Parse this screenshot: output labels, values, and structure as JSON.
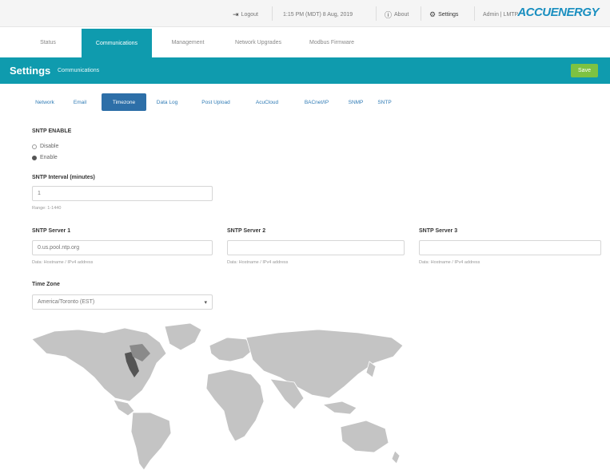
{
  "topbar": {
    "logout": "Logout",
    "datetime": "1:15 PM (MDT) 8 Aug, 2019",
    "about": "About",
    "settings": "Settings",
    "user": "Admin | LMTP",
    "brand": "ACCUENERGY"
  },
  "nav": {
    "tabs": [
      "Status",
      "Communications",
      "Management",
      "Network Upgrades",
      "Modbus Firmware"
    ]
  },
  "header": {
    "title": "Settings",
    "subtitle": "Communications",
    "save": "Save"
  },
  "subtabs": [
    "Network",
    "Email",
    "Timezone",
    "Data Log",
    "Post Upload",
    "AcuCloud",
    "BACnet/IP",
    "SNMP",
    "SNTP"
  ],
  "form": {
    "sntp_enable_label": "SNTP ENABLE",
    "opt_disable": "Disable",
    "opt_enable": "Enable",
    "interval_label": "SNTP Interval (minutes)",
    "interval_value": "1",
    "interval_help": "Range: 1-1440",
    "server1_label": "SNTP Server 1",
    "server1_value": "0.us.pool.ntp.org",
    "server1_help": "Data: Hostname / IPv4 address",
    "server2_label": "SNTP Server 2",
    "server2_value": "",
    "server2_help": "Data: Hostname / IPv4 address",
    "server3_label": "SNTP Server 3",
    "server3_value": "",
    "server3_help": "Data: Hostname / IPv4 address",
    "timezone_label": "Time Zone",
    "timezone_value": "America/Toronto (EST)"
  },
  "colors": {
    "accent": "#0f9bae",
    "save": "#7dc242",
    "subtab_active": "#2d6fa8",
    "map_land": "#c4c4c4",
    "map_highlight": "#555555"
  }
}
